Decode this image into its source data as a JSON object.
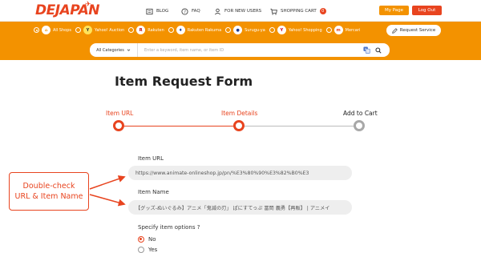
{
  "header": {
    "logo_text": "DEJAPAN",
    "nav": [
      {
        "label": "BLOG",
        "icon": "blog-icon"
      },
      {
        "label": "FAQ",
        "icon": "help-icon"
      },
      {
        "label": "FOR NEW USERS",
        "icon": "user-icon"
      },
      {
        "label": "SHOPPING CART",
        "icon": "cart-icon"
      }
    ],
    "cart_count": "0",
    "my_page_label": "My Page",
    "logout_label": "Log Out"
  },
  "shops": {
    "items": [
      {
        "label": "All Shops",
        "checked": true
      },
      {
        "label": "Yahoo! Auction",
        "checked": false
      },
      {
        "label": "Rakuten",
        "checked": false
      },
      {
        "label": "Rakuten Rakuma",
        "checked": false
      },
      {
        "label": "Surugu-ya",
        "checked": false
      },
      {
        "label": "Yahoo! Shopping",
        "checked": false
      },
      {
        "label": "Mercari",
        "checked": false
      }
    ],
    "request_service_label": "Request Service"
  },
  "search": {
    "category_label": "All Categories",
    "placeholder": "Enter a keyword, item name, or item ID"
  },
  "form": {
    "title": "Item Request Form",
    "steps": [
      {
        "label": "Item URL",
        "state": "done"
      },
      {
        "label": "Item Details",
        "state": "current"
      },
      {
        "label": "Add to Cart",
        "state": "pending"
      }
    ],
    "url_label": "Item URL",
    "url_value": "https://www.animate-onlineshop.jp/pn/%E3%80%90%E3%82%B0%E3",
    "name_label": "Item Name",
    "name_value": "【グッズ-ぬいぐるみ】アニメ「鬼滅の刃」 ぱにすてっぷ 冨岡 義勇【再販】 | アニメイ",
    "options_label": "Specify item options ?",
    "options": [
      {
        "label": "No",
        "checked": true
      },
      {
        "label": "Yes",
        "checked": false
      }
    ]
  },
  "annotation": {
    "line1": "Double-check",
    "line2": "URL & Item Name"
  },
  "colors": {
    "brand_orange": "#f39200",
    "brand_red": "#e8441f"
  }
}
